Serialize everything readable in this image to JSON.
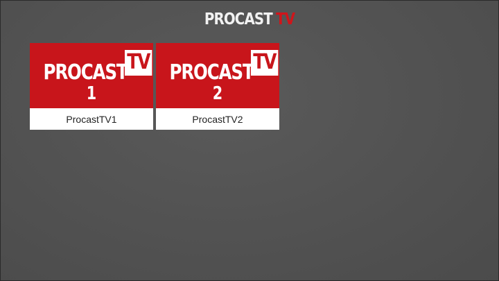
{
  "header": {
    "logo_word1": "PROCAST",
    "logo_word2": "TV"
  },
  "channels": [
    {
      "brand": "PROCAST",
      "tv": "TV",
      "number": "1",
      "label": "ProcastTV1"
    },
    {
      "brand": "PROCAST",
      "tv": "TV",
      "number": "2",
      "label": "ProcastTV2"
    }
  ],
  "colors": {
    "accent_red": "#c8151b",
    "background": "#535353",
    "tile_label_bg": "#ffffff"
  }
}
